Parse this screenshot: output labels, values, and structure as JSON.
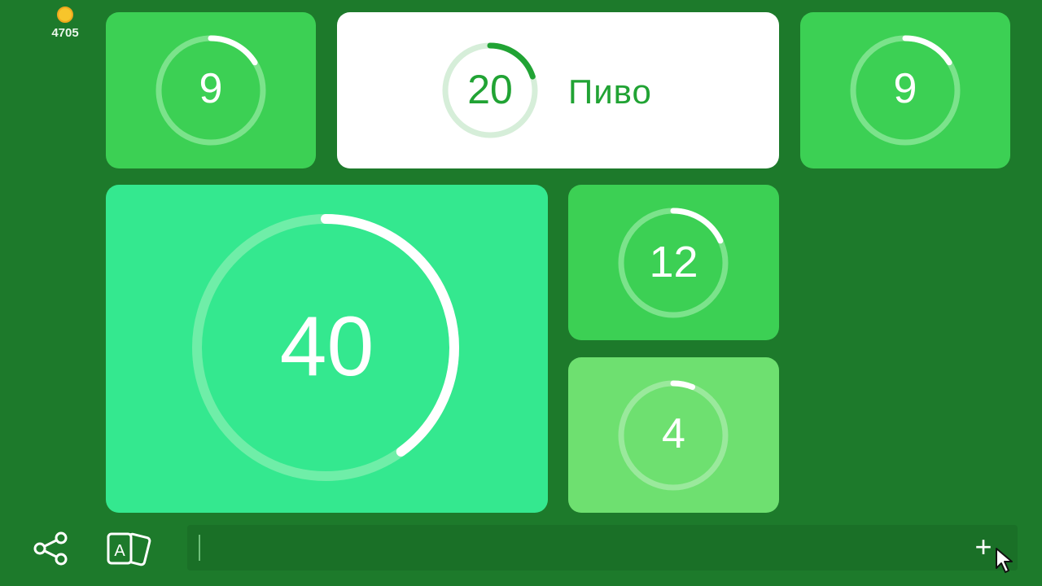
{
  "header": {
    "coins": "4705",
    "coin_color": "#f7c52b"
  },
  "tiles": [
    {
      "id": "top-left",
      "number": "9",
      "progress": 0.16,
      "color": "#3cd054",
      "state": "unanswered"
    },
    {
      "id": "top-middle",
      "number": "20",
      "progress": 0.2,
      "color": "#ffffff",
      "state": "answered",
      "answer": "Пиво"
    },
    {
      "id": "top-right",
      "number": "9",
      "progress": 0.16,
      "color": "#3cd054",
      "state": "unanswered"
    },
    {
      "id": "big",
      "number": "40",
      "progress": 0.4,
      "color": "#34e88f",
      "state": "unanswered"
    },
    {
      "id": "mid-right",
      "number": "12",
      "progress": 0.18,
      "color": "#3cd054",
      "state": "unanswered"
    },
    {
      "id": "low-right",
      "number": "4",
      "progress": 0.06,
      "color": "#6ee070",
      "state": "unanswered"
    }
  ],
  "bottom_bar": {
    "share_icon": "share-icon",
    "cards_icon": "cards-icon",
    "cards_letter": "A",
    "input_value": "",
    "submit_icon": "plus-icon",
    "submit_label": "+"
  }
}
